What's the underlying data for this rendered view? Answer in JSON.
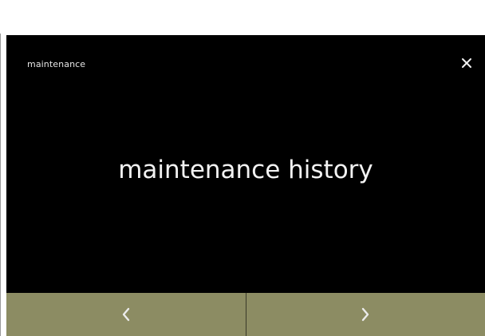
{
  "header": {
    "title": "maintenance"
  },
  "main": {
    "label": "maintenance history"
  },
  "icons": {
    "close": "close-icon",
    "previous": "chevron-left-icon",
    "next": "chevron-right-icon"
  },
  "colors": {
    "screen_background": "#000000",
    "text": "#f2f2f2",
    "nav_button": "#8c8c63",
    "nav_icon": "#ececec"
  }
}
